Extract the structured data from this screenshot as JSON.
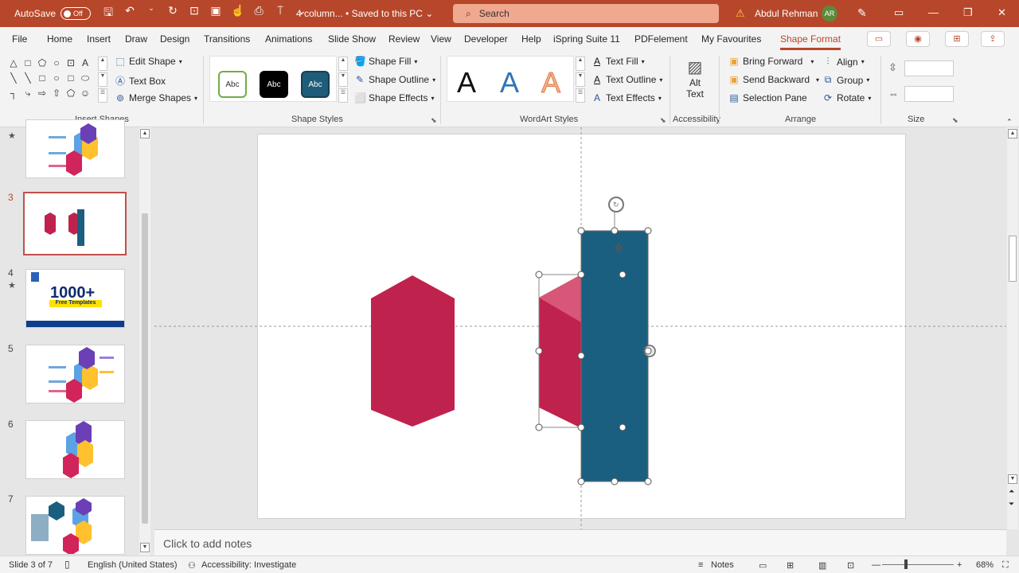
{
  "titlebar": {
    "autosave_label": "AutoSave",
    "autosave_state": "Off",
    "document_title": "4 column... • Saved to this PC ⌄",
    "search_placeholder": "Search",
    "user_name": "Abdul Rehman",
    "user_initials": "AR"
  },
  "menu": {
    "tabs": [
      "File",
      "Home",
      "Insert",
      "Draw",
      "Design",
      "Transitions",
      "Animations",
      "Slide Show",
      "Review",
      "View",
      "Developer",
      "Help",
      "iSpring Suite 11",
      "PDFelement",
      "My Favourites",
      "Shape Format"
    ],
    "active": "Shape Format"
  },
  "ribbon": {
    "insert_shapes": {
      "label": "Insert Shapes",
      "edit_shape": "Edit Shape",
      "text_box": "Text Box",
      "merge_shapes": "Merge Shapes",
      "gallery": [
        "△",
        "□",
        "⬠",
        "○",
        "⊡",
        "A",
        "╲",
        "╲",
        "□",
        "○",
        "□",
        "⬭",
        "┐",
        "⤷",
        "⇨",
        "⇧",
        "⬠",
        "☺"
      ]
    },
    "shape_styles": {
      "label": "Shape Styles",
      "samples": [
        {
          "text": "Abc",
          "bg": "#ffffff",
          "border": "#70ad47",
          "fg": "#333333"
        },
        {
          "text": "Abc",
          "bg": "#000000",
          "border": "#000000",
          "fg": "#ffffff"
        },
        {
          "text": "Abc",
          "bg": "#1f5c7a",
          "border": "#163f55",
          "fg": "#ffffff"
        }
      ],
      "shape_fill": "Shape Fill",
      "shape_outline": "Shape Outline",
      "shape_effects": "Shape Effects"
    },
    "wordart_styles": {
      "label": "WordArt Styles",
      "letters": [
        {
          "char": "A",
          "color": "#111111"
        },
        {
          "char": "A",
          "color": "#2e75b6"
        },
        {
          "char": "A",
          "color": "#f4b183"
        }
      ],
      "text_fill": "Text Fill",
      "text_outline": "Text Outline",
      "text_effects": "Text Effects"
    },
    "accessibility": {
      "label": "Accessibility",
      "alt_text_line1": "Alt",
      "alt_text_line2": "Text"
    },
    "arrange": {
      "label": "Arrange",
      "bring_forward": "Bring Forward",
      "send_backward": "Send Backward",
      "selection_pane": "Selection Pane",
      "align": "Align",
      "group": "Group",
      "rotate": "Rotate"
    },
    "size": {
      "label": "Size"
    }
  },
  "thumbnails": [
    {
      "number": "",
      "star": true,
      "selected": false
    },
    {
      "number": "3",
      "star": false,
      "selected": true
    },
    {
      "number": "4",
      "star": true,
      "selected": false,
      "badge": "1000+",
      "badge_sub": "Free Templates"
    },
    {
      "number": "5",
      "star": false,
      "selected": false
    },
    {
      "number": "6",
      "star": false,
      "selected": false
    },
    {
      "number": "7",
      "star": false,
      "selected": false
    }
  ],
  "notes": {
    "placeholder": "Click to add notes"
  },
  "statusbar": {
    "slide_info": "Slide 3 of 7",
    "language": "English (United States)",
    "accessibility": "Accessibility: Investigate",
    "notes": "Notes",
    "zoom": "68%"
  },
  "colors": {
    "accent": "#b7472a",
    "hexagon": "#c0224e",
    "hexagon_light": "#d85677",
    "rect_teal": "#1b5f80"
  }
}
